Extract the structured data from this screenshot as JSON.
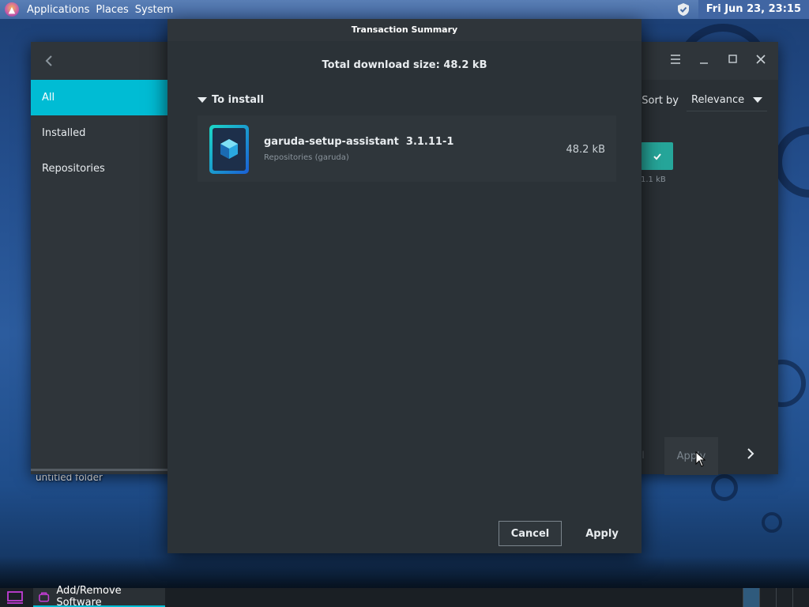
{
  "top_panel": {
    "menus": [
      "Applications",
      "Places",
      "System"
    ],
    "clock": "Fri Jun 23, 23:15"
  },
  "desktop": {
    "folder_label": "untitled folder"
  },
  "app_window": {
    "sidebar": {
      "items": [
        {
          "label": "All",
          "active": true
        },
        {
          "label": "Installed",
          "active": false
        },
        {
          "label": "Repositories",
          "active": false
        }
      ]
    },
    "sort": {
      "label": "Sort by",
      "value": "Relevance"
    },
    "behind_size": "1.1 kB",
    "apply_label": "Apply"
  },
  "dialog": {
    "title": "Transaction Summary",
    "download_size": "Total download size: 48.2 kB",
    "section_label": "To install",
    "package": {
      "name": "garuda-setup-assistant",
      "version": "3.1.11-1",
      "repo": "Repositories (garuda)",
      "size": "48.2 kB"
    },
    "buttons": {
      "cancel": "Cancel",
      "apply": "Apply"
    }
  },
  "taskbar": {
    "task_label": "Add/Remove Software"
  },
  "colors": {
    "accent": "#00bcd4",
    "check_green": "#26a69a",
    "panel": "#456ba5"
  }
}
